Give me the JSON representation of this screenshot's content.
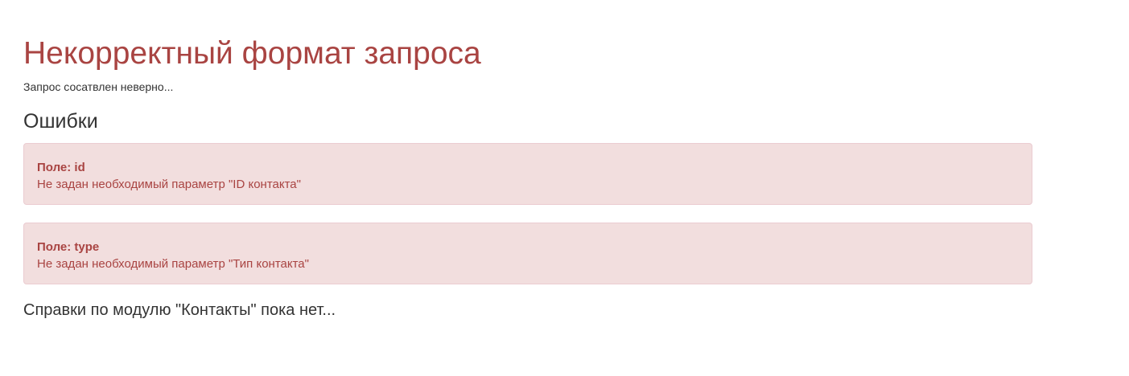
{
  "page": {
    "title": "Некорректный формат запроса",
    "subtitle": "Запрос сосатвлен неверно..."
  },
  "errors": {
    "heading": "Ошибки",
    "items": [
      {
        "field": "Поле: id",
        "message": "Не задан необходимый параметр \"ID контакта\""
      },
      {
        "field": "Поле: type",
        "message": "Не задан необходимый параметр \"Тип контакта\""
      }
    ]
  },
  "help": {
    "text": "Справки по модулю \"Контакты\" пока нет..."
  },
  "colors": {
    "danger_text": "#a94442",
    "danger_bg": "#f2dede",
    "danger_border": "#ebccd1"
  }
}
